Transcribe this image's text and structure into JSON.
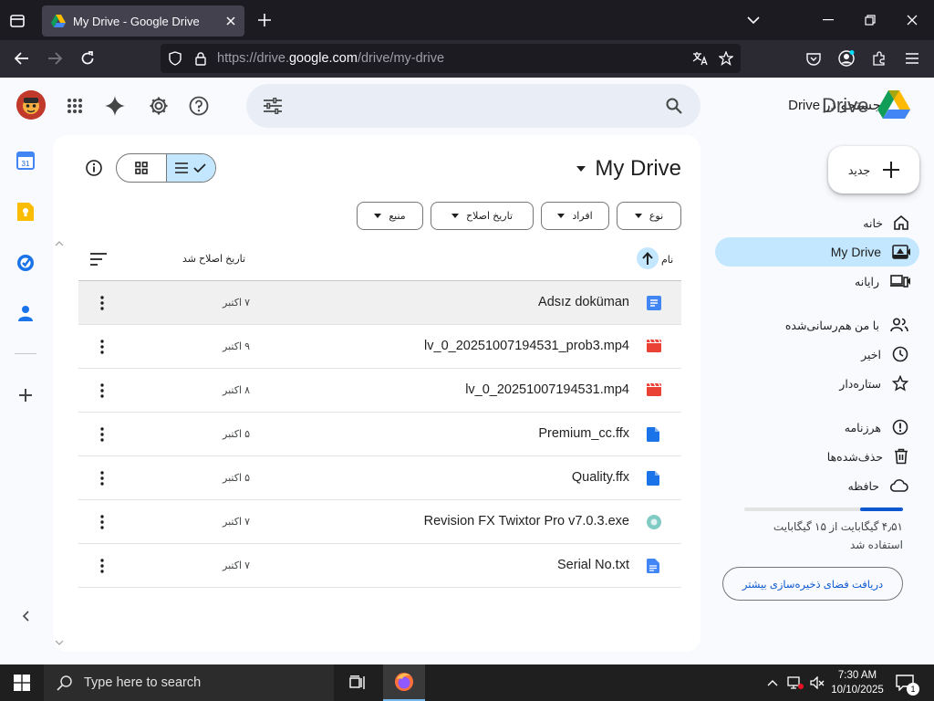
{
  "browser": {
    "tab_title": "My Drive - Google Drive",
    "url_prefix": "https://drive.",
    "url_domain": "google.com",
    "url_path": "/drive/my-drive"
  },
  "header": {
    "search_placeholder": "جستجو در Drive",
    "app_name": "Drive"
  },
  "main": {
    "title": "My Drive",
    "filters": [
      "نوع",
      "افراد",
      "تاریخ اصلاح",
      "منبع"
    ],
    "columns": {
      "name": "نام",
      "modified": "تاریخ اصلاح شد"
    },
    "files": [
      {
        "name": "Adsız doküman",
        "date": "۷ اکتبر",
        "icon": "google-doc-icon"
      },
      {
        "name": "lv_0_20251007194531_prob3.mp4",
        "date": "۹ اکتبر",
        "icon": "video-icon"
      },
      {
        "name": "lv_0_20251007194531.mp4",
        "date": "۸ اکتبر",
        "icon": "video-icon"
      },
      {
        "name": "Premium_cc.ffx",
        "date": "۵ اکتبر",
        "icon": "file-icon"
      },
      {
        "name": "Quality.ffx",
        "date": "۵ اکتبر",
        "icon": "file-icon"
      },
      {
        "name": "Revision FX Twixtor Pro v7.0.3.exe",
        "date": "۷ اکتبر",
        "icon": "exe-icon"
      },
      {
        "name": "Serial No.txt",
        "date": "۷ اکتبر",
        "icon": "text-file-icon"
      }
    ]
  },
  "sidebar": {
    "new_label": "جدید",
    "items": [
      {
        "label": "خانه",
        "icon": "home-icon"
      },
      {
        "label": "My Drive",
        "icon": "my-drive-icon"
      },
      {
        "label": "رایانه",
        "icon": "computers-icon"
      },
      {
        "label": "با من هم‌رسانی‌شده",
        "icon": "shared-icon"
      },
      {
        "label": "اخیر",
        "icon": "clock-icon"
      },
      {
        "label": "ستاره‌دار",
        "icon": "star-icon"
      },
      {
        "label": "هرزنامه",
        "icon": "spam-icon"
      },
      {
        "label": "حذف‌شده‌ها",
        "icon": "trash-icon"
      },
      {
        "label": "حافظه",
        "icon": "cloud-icon"
      }
    ],
    "storage_used": 0.27,
    "storage_text_1": "۴٫۵۱ گیگابایت از ۱۵ گیگابایت",
    "storage_text_2": "استفاده شد",
    "get_storage": "دریافت فضای ذخیره‌سازی بیشتر"
  },
  "taskbar": {
    "search_placeholder": "Type here to search",
    "time": "7:30 AM",
    "date": "10/10/2025",
    "notification_count": "1"
  },
  "colors": {
    "accent": "#0b57d0",
    "selected_nav": "#c2e7ff",
    "doc_blue": "#4285f4",
    "video_red": "#ea4335"
  }
}
